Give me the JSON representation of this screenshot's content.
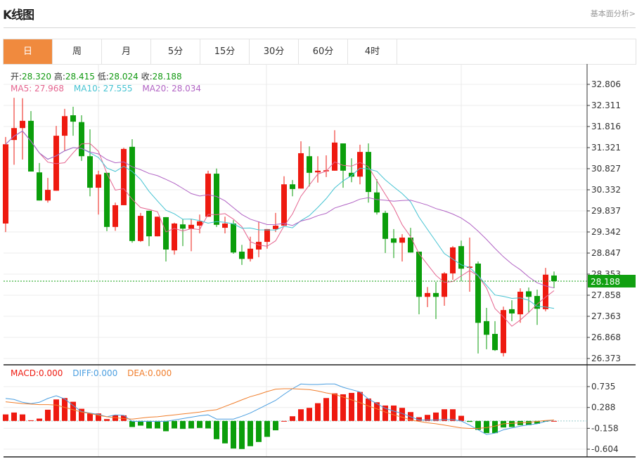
{
  "header": {
    "title": "K线图",
    "link": "基本面分析>"
  },
  "tabs": [
    {
      "label": "日",
      "active": true
    },
    {
      "label": "周"
    },
    {
      "label": "月"
    },
    {
      "label": "5分"
    },
    {
      "label": "15分"
    },
    {
      "label": "30分"
    },
    {
      "label": "60分"
    },
    {
      "label": "4时"
    }
  ],
  "ohlc": {
    "open_label": "开:",
    "open": "28.320",
    "high_label": "高:",
    "high": "28.415",
    "low_label": "低:",
    "low": "28.024",
    "close_label": "收:",
    "close": "28.188"
  },
  "ma": {
    "ma5": "MA5: 27.968",
    "ma10": "MA10: 27.555",
    "ma20": "MA20: 28.034"
  },
  "macd_legend": {
    "macd": "MACD:0.000",
    "diff": "DIFF:0.000",
    "dea": "DEA:0.000"
  },
  "colors": {
    "up": "#ee1a10",
    "down": "#0b9e0b",
    "ma5": "#e5648f",
    "ma10": "#45c3d2",
    "ma20": "#b163c4",
    "diff": "#4a9ee0",
    "dea": "#f07e2c",
    "active_tab": "#f08a3e",
    "price_tag": "#11a011"
  },
  "chart_data": [
    {
      "type": "candlestick",
      "ylim": [
        26.225,
        33.284
      ],
      "y_ticks": [
        "32.806",
        "32.311",
        "31.816",
        "31.321",
        "30.827",
        "30.332",
        "29.837",
        "29.342",
        "28.847",
        "28.353",
        "27.858",
        "27.363",
        "26.868",
        "26.373"
      ],
      "last_price": "28.188",
      "ohlc": [
        [
          29.54,
          31.57,
          29.34,
          31.4
        ],
        [
          31.5,
          32.49,
          30.92,
          31.78
        ],
        [
          31.78,
          32.48,
          31.04,
          31.95
        ],
        [
          31.95,
          32.18,
          30.76,
          30.76
        ],
        [
          30.74,
          30.96,
          30.08,
          30.08
        ],
        [
          30.08,
          30.61,
          30.03,
          30.33
        ],
        [
          30.31,
          31.83,
          30.31,
          31.6
        ],
        [
          31.6,
          32.23,
          31.24,
          32.06
        ],
        [
          32.08,
          32.28,
          31.6,
          31.93
        ],
        [
          31.92,
          32.08,
          31.01,
          31.12
        ],
        [
          31.12,
          31.75,
          30.18,
          30.38
        ],
        [
          30.38,
          30.78,
          29.75,
          30.69
        ],
        [
          30.73,
          30.73,
          29.36,
          29.46
        ],
        [
          29.46,
          30.03,
          29.37,
          29.97
        ],
        [
          29.97,
          31.32,
          29.97,
          31.29
        ],
        [
          31.34,
          31.52,
          29.09,
          29.13
        ],
        [
          29.13,
          29.79,
          29.11,
          29.72
        ],
        [
          29.84,
          29.84,
          29.01,
          29.24
        ],
        [
          29.24,
          29.7,
          29.24,
          29.7
        ],
        [
          29.69,
          29.69,
          28.65,
          28.93
        ],
        [
          28.91,
          29.56,
          28.81,
          29.54
        ],
        [
          29.52,
          29.64,
          29.01,
          29.42
        ],
        [
          29.42,
          29.64,
          28.89,
          29.51
        ],
        [
          29.49,
          29.75,
          29.31,
          29.59
        ],
        [
          29.7,
          30.78,
          29.7,
          30.71
        ],
        [
          30.71,
          30.83,
          29.46,
          29.51
        ],
        [
          29.44,
          29.7,
          29.31,
          29.54
        ],
        [
          29.54,
          29.62,
          28.83,
          28.86
        ],
        [
          28.88,
          29.04,
          28.57,
          28.71
        ],
        [
          28.71,
          29.23,
          28.65,
          28.95
        ],
        [
          28.93,
          29.59,
          28.75,
          29.11
        ],
        [
          29.11,
          29.41,
          28.95,
          29.41
        ],
        [
          29.41,
          29.79,
          29.34,
          29.49
        ],
        [
          29.49,
          30.65,
          29.49,
          30.46
        ],
        [
          30.46,
          30.56,
          30.18,
          30.35
        ],
        [
          30.36,
          31.47,
          30.36,
          31.19
        ],
        [
          31.12,
          31.35,
          30.41,
          30.73
        ],
        [
          30.74,
          31.12,
          30.5,
          30.78
        ],
        [
          30.78,
          31.14,
          30.63,
          30.79
        ],
        [
          30.78,
          31.73,
          30.78,
          31.44
        ],
        [
          31.42,
          31.42,
          30.38,
          30.78
        ],
        [
          30.73,
          31.07,
          30.51,
          30.64
        ],
        [
          30.64,
          31.39,
          30.46,
          31.22
        ],
        [
          31.22,
          31.42,
          30.03,
          30.28
        ],
        [
          30.27,
          30.58,
          29.75,
          29.8
        ],
        [
          29.79,
          29.84,
          28.85,
          29.18
        ],
        [
          29.19,
          29.41,
          28.73,
          29.09
        ],
        [
          29.09,
          29.29,
          28.65,
          29.21
        ],
        [
          29.21,
          29.44,
          28.86,
          28.86
        ],
        [
          28.88,
          28.88,
          27.41,
          27.82
        ],
        [
          27.82,
          28.05,
          27.58,
          27.91
        ],
        [
          27.91,
          28.17,
          27.3,
          27.82
        ],
        [
          27.82,
          28.4,
          27.61,
          28.37
        ],
        [
          28.37,
          29.01,
          28.22,
          28.98
        ],
        [
          29.01,
          29.14,
          28.19,
          28.48
        ],
        [
          28.5,
          29.21,
          27.94,
          28.53
        ],
        [
          28.6,
          28.65,
          26.49,
          27.21
        ],
        [
          27.25,
          27.56,
          26.59,
          26.93
        ],
        [
          26.95,
          27.25,
          26.55,
          26.57
        ],
        [
          26.5,
          27.59,
          26.42,
          27.51
        ],
        [
          27.53,
          27.74,
          27.25,
          27.43
        ],
        [
          27.41,
          28.02,
          27.21,
          27.94
        ],
        [
          27.95,
          28.04,
          27.44,
          27.82
        ],
        [
          27.84,
          27.99,
          27.16,
          27.54
        ],
        [
          27.53,
          28.5,
          27.48,
          28.34
        ],
        [
          28.32,
          28.415,
          28.024,
          28.188
        ]
      ]
    },
    {
      "type": "bar+line",
      "ylim": [
        -0.769,
        1.201
      ],
      "y_ticks": [
        "0.735",
        "0.288",
        "-0.158",
        "-0.604"
      ],
      "macd": [
        0.14,
        0.18,
        0.14,
        0.015,
        0.05,
        0.24,
        0.46,
        0.49,
        0.41,
        0.26,
        0.16,
        0.16,
        0.04,
        0.12,
        0.12,
        -0.13,
        -0.1,
        -0.16,
        -0.16,
        -0.22,
        -0.16,
        -0.17,
        -0.16,
        -0.15,
        -0.16,
        -0.39,
        -0.48,
        -0.59,
        -0.6,
        -0.54,
        -0.45,
        -0.34,
        -0.2,
        0.0,
        0.1,
        0.25,
        0.28,
        0.38,
        0.49,
        0.59,
        0.57,
        0.6,
        0.62,
        0.48,
        0.4,
        0.33,
        0.33,
        0.28,
        0.19,
        0.08,
        0.13,
        0.18,
        0.25,
        0.25,
        0.11,
        -0.02,
        -0.19,
        -0.26,
        -0.26,
        -0.14,
        -0.13,
        -0.09,
        -0.09,
        -0.06,
        -0.01,
        0.0
      ],
      "diff": [
        0.48,
        0.46,
        0.4,
        0.37,
        0.4,
        0.48,
        0.54,
        0.47,
        0.33,
        0.2,
        0.17,
        0.14,
        0.09,
        0.13,
        0.12,
        -0.01,
        -0.01,
        -0.01,
        -0.01,
        -0.01,
        0.02,
        0.05,
        0.08,
        0.11,
        0.13,
        0.04,
        0.04,
        0.04,
        0.1,
        0.17,
        0.26,
        0.35,
        0.44,
        0.57,
        0.69,
        0.79,
        0.78,
        0.78,
        0.79,
        0.79,
        0.72,
        0.67,
        0.62,
        0.47,
        0.37,
        0.27,
        0.21,
        0.16,
        0.09,
        0.02,
        0.02,
        0.02,
        0.03,
        0.03,
        0.0,
        -0.09,
        -0.19,
        -0.29,
        -0.26,
        -0.19,
        -0.15,
        -0.11,
        -0.08,
        -0.06,
        -0.01,
        0.02
      ],
      "dea": [
        0.41,
        0.39,
        0.37,
        0.36,
        0.35,
        0.35,
        0.34,
        0.29,
        0.24,
        0.19,
        0.16,
        0.12,
        0.09,
        0.07,
        0.05,
        0.04,
        0.06,
        0.08,
        0.09,
        0.11,
        0.13,
        0.15,
        0.17,
        0.19,
        0.22,
        0.24,
        0.31,
        0.38,
        0.45,
        0.52,
        0.57,
        0.63,
        0.68,
        0.69,
        0.69,
        0.68,
        0.67,
        0.64,
        0.6,
        0.57,
        0.51,
        0.45,
        0.39,
        0.32,
        0.26,
        0.19,
        0.13,
        0.08,
        0.02,
        -0.01,
        -0.04,
        -0.06,
        -0.09,
        -0.12,
        -0.15,
        -0.16,
        -0.16,
        -0.14,
        -0.11,
        -0.06,
        -0.05,
        -0.04,
        -0.03,
        -0.01,
        0.01,
        0.02
      ]
    }
  ]
}
